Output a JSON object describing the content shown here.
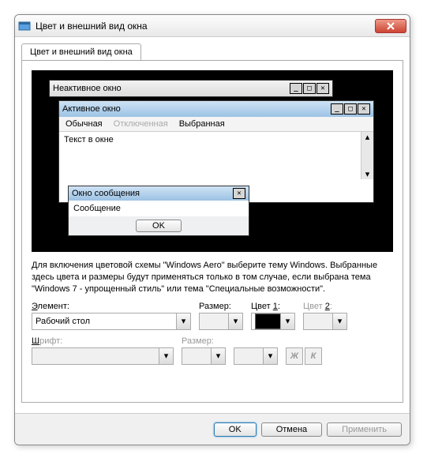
{
  "window": {
    "title": "Цвет и внешний вид окна",
    "close_icon": "×"
  },
  "tab": {
    "label": "Цвет и внешний вид окна"
  },
  "preview": {
    "inactive_title": "Неактивное окно",
    "active_title": "Активное окно",
    "menu": {
      "normal": "Обычная",
      "disabled": "Отключенная",
      "selected": "Выбранная"
    },
    "textbox": "Текст в окне",
    "msg_title": "Окно сообщения",
    "msg_text": "Сообщение",
    "msg_ok": "OK",
    "win_min": "_",
    "win_max": "□",
    "win_close": "✕"
  },
  "description": "Для включения цветовой схемы \"Windows Aero\" выберите тему Windows. Выбранные здесь цвета и размеры будут применяться только в том случае, если выбрана тема \"Windows 7 - упрощенный стиль\" или тема \"Специальные возможности\".",
  "fields": {
    "element_label": "Элемент:",
    "element_value": "Рабочий стол",
    "size_label": "Размер:",
    "color1_label": "Цвет 1:",
    "color2_label": "Цвет 2:",
    "font_label": "Шрифт:",
    "fsize_label": "Размер:",
    "bold": "Ж",
    "italic": "К"
  },
  "buttons": {
    "ok": "OK",
    "cancel": "Отмена",
    "apply": "Применить"
  }
}
